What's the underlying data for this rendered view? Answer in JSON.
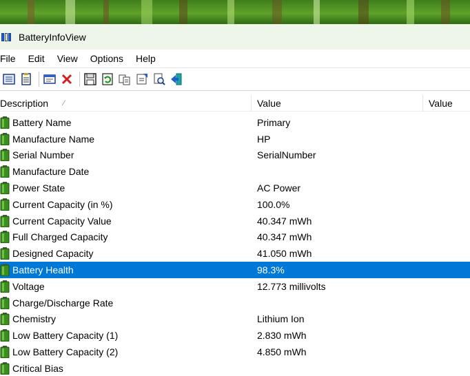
{
  "window": {
    "title": "BatteryInfoView"
  },
  "menu": [
    "File",
    "Edit",
    "View",
    "Options",
    "Help"
  ],
  "toolbar": {
    "buttons": [
      "properties-icon",
      "report-icon",
      "separator",
      "html-report-icon",
      "delete-icon",
      "separator",
      "save-icon",
      "refresh-icon",
      "copy-icon",
      "properties-sheet-icon",
      "find-icon",
      "exit-icon"
    ]
  },
  "columns": {
    "description": "Description",
    "value1": "Value",
    "value2": "Value"
  },
  "colors": {
    "selected": "#0078d7",
    "battery": "#3a8e1e"
  },
  "rows": [
    {
      "label": "Battery Name",
      "value": "Primary"
    },
    {
      "label": "Manufacture Name",
      "value": "HP"
    },
    {
      "label": "Serial Number",
      "value": "SerialNumber"
    },
    {
      "label": "Manufacture Date",
      "value": ""
    },
    {
      "label": "Power State",
      "value": "AC Power"
    },
    {
      "label": "Current Capacity (in %)",
      "value": "100.0%"
    },
    {
      "label": "Current Capacity Value",
      "value": "40.347 mWh"
    },
    {
      "label": "Full Charged Capacity",
      "value": "40.347 mWh"
    },
    {
      "label": "Designed Capacity",
      "value": "41.050 mWh"
    },
    {
      "label": "Battery Health",
      "value": "98.3%",
      "selected": true
    },
    {
      "label": "Voltage",
      "value": "12.773 millivolts"
    },
    {
      "label": "Charge/Discharge Rate",
      "value": ""
    },
    {
      "label": "Chemistry",
      "value": "Lithium Ion"
    },
    {
      "label": "Low Battery Capacity (1)",
      "value": "2.830 mWh"
    },
    {
      "label": "Low Battery Capacity (2)",
      "value": "4.850 mWh"
    },
    {
      "label": "Critical Bias",
      "value": ""
    }
  ]
}
